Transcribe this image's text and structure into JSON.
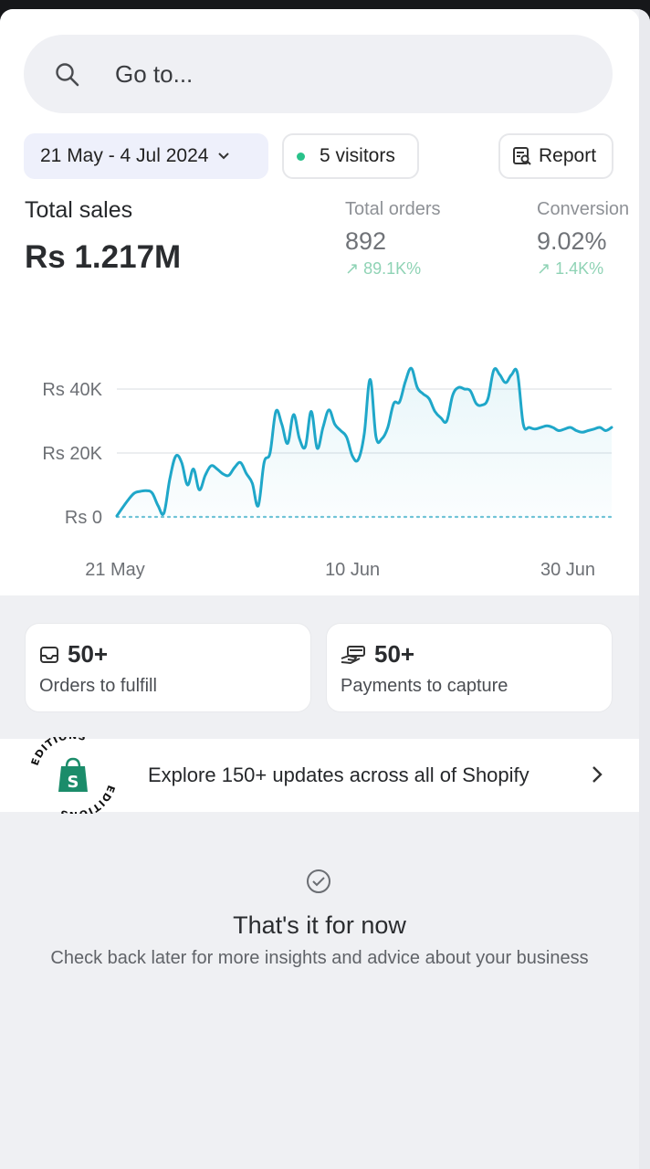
{
  "search": {
    "placeholder": "Go to..."
  },
  "filters": {
    "date_range": "21 May - 4 Jul 2024",
    "visitors": "5 visitors",
    "report_label": "Report"
  },
  "summary": {
    "total_sales_label": "Total sales",
    "total_sales_value": "Rs 1.217M",
    "total_orders_label": "Total orders",
    "total_orders_value": "892",
    "total_orders_change": "↗ 89.1K%",
    "conversion_label": "Conversion",
    "conversion_value": "9.02%",
    "conversion_change": "↗ 1.4K%"
  },
  "chart_data": {
    "type": "line",
    "title": "",
    "xlabel": "",
    "ylabel": "",
    "ylim": [
      0,
      50000
    ],
    "y_ticks": [
      "Rs 0",
      "Rs 20K",
      "Rs 40K"
    ],
    "y_tick_values": [
      0,
      20000,
      40000
    ],
    "x_ticks": [
      "21 May",
      "10 Jun",
      "30 Jun"
    ],
    "x_tick_days": [
      0,
      20,
      40
    ],
    "colors": {
      "current": "#1fa7c9",
      "comparison": "#6fc3d6",
      "grid": "#e6e8ec"
    },
    "series": [
      {
        "x": [
          0,
          0.5,
          1,
          1.5,
          2,
          2.5,
          3,
          3.5,
          4,
          4.5,
          5,
          5.5,
          6,
          6.5,
          7,
          7.5,
          8,
          8.5,
          9,
          9.5,
          10,
          10.5,
          11,
          11.5,
          12,
          12.5,
          13,
          13.5,
          14,
          14.5,
          15,
          15.5,
          16,
          16.5,
          17,
          17.5,
          18,
          18.5,
          19,
          19.5,
          20,
          20.5,
          21,
          21.5,
          22,
          22.5,
          23,
          23.5,
          24,
          24.5,
          25,
          25.5,
          26,
          26.5,
          27,
          27.5,
          28,
          28.5,
          29,
          29.5,
          30,
          30.5,
          31,
          31.5,
          32,
          32.5,
          33,
          33.5,
          34,
          34.5,
          35,
          35.5,
          36,
          36.5,
          37,
          37.5,
          38,
          38.5,
          39,
          39.5,
          40,
          40.5,
          41,
          41.5,
          42
        ],
        "values": [
          300,
          3000,
          5500,
          7500,
          8000,
          8200,
          7500,
          3500,
          1200,
          12000,
          19000,
          17000,
          10000,
          15000,
          8500,
          13000,
          16000,
          15000,
          13500,
          13000,
          15500,
          17000,
          13500,
          10500,
          3500,
          17000,
          20000,
          33000,
          29000,
          23000,
          32000,
          24500,
          22000,
          33000,
          21500,
          28000,
          33500,
          29000,
          27000,
          25000,
          19000,
          18000,
          26000,
          43000,
          25000,
          24500,
          28000,
          35500,
          36000,
          42500,
          46500,
          40500,
          38500,
          37000,
          33000,
          31000,
          30000,
          38000,
          40500,
          40000,
          39500,
          35500,
          35000,
          37000,
          46000,
          44500,
          42000,
          44500,
          45000,
          29000,
          28000,
          27500,
          28000,
          28500,
          28000,
          27000,
          27500,
          28000,
          27000,
          26500,
          27000,
          27500,
          28000,
          27000,
          28000
        ]
      },
      {
        "x": [
          0,
          42
        ],
        "values": [
          0,
          0
        ]
      }
    ]
  },
  "tasks": [
    {
      "count": "50+",
      "label": "Orders to fulfill"
    },
    {
      "count": "50+",
      "label": "Payments to capture"
    }
  ],
  "banner": {
    "text": "Explore 150+ updates across all of Shopify",
    "badge_text": "EDITIONS",
    "icon": "shopify-bag-icon"
  },
  "empty_state": {
    "title": "That's it for now",
    "subtitle": "Check back later for more insights and advice about your business"
  }
}
